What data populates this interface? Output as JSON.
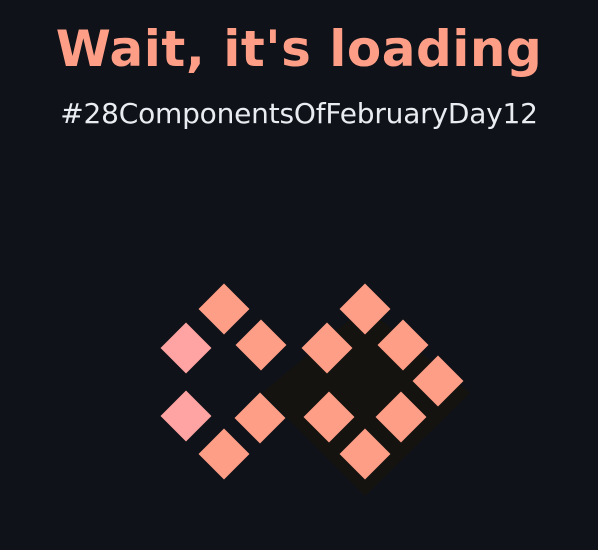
{
  "header": {
    "title": "Wait, it's loading",
    "hashtag": "#28ComponentsOfFebruaryDay12"
  },
  "colors": {
    "background": "#0f1218",
    "title": "#ff9e87",
    "hashtag": "#e9edf1",
    "tile": "#ff9e87",
    "tile_alt": "#ffa3a3",
    "shadow": "#14130f"
  },
  "loader": {
    "icon": "infinity-diamond-tiles-icon"
  }
}
